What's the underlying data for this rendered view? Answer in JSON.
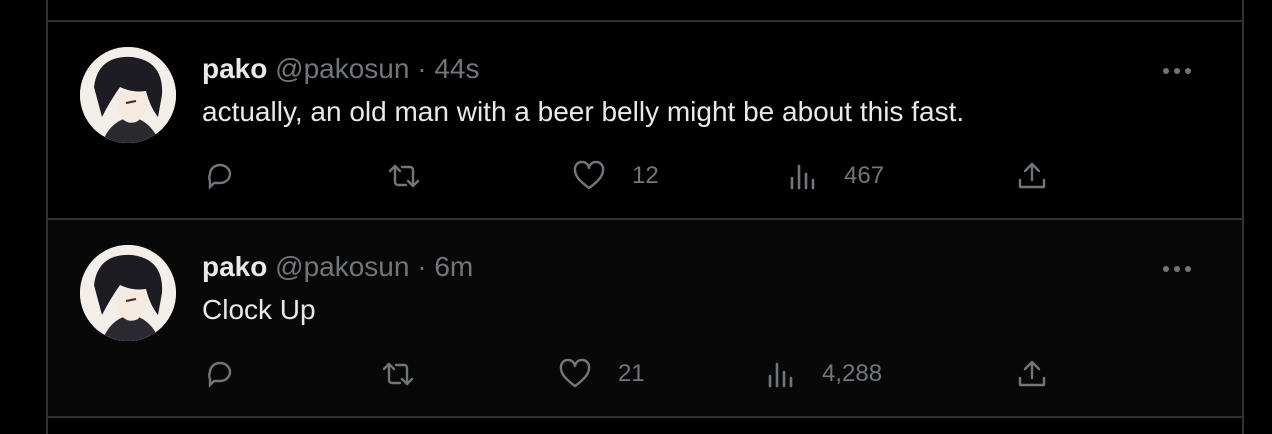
{
  "tweets": [
    {
      "display_name": "pako",
      "handle": "@pakosun",
      "separator": "·",
      "time": "44s",
      "text": "actually, an old man with a beer belly might be about this fast.",
      "likes": "12",
      "views": "467"
    },
    {
      "display_name": "pako",
      "handle": "@pakosun",
      "separator": "·",
      "time": "6m",
      "text": "Clock Up",
      "likes": "21",
      "views": "4,288"
    }
  ],
  "icons": {
    "reply": "reply-icon",
    "retweet": "retweet-icon",
    "like": "heart-icon",
    "views": "views-icon",
    "share": "share-icon",
    "more": "more-icon"
  },
  "colors": {
    "background": "#000000",
    "text": "#e7e9ea",
    "muted": "#71767b",
    "border": "#2f3336"
  }
}
